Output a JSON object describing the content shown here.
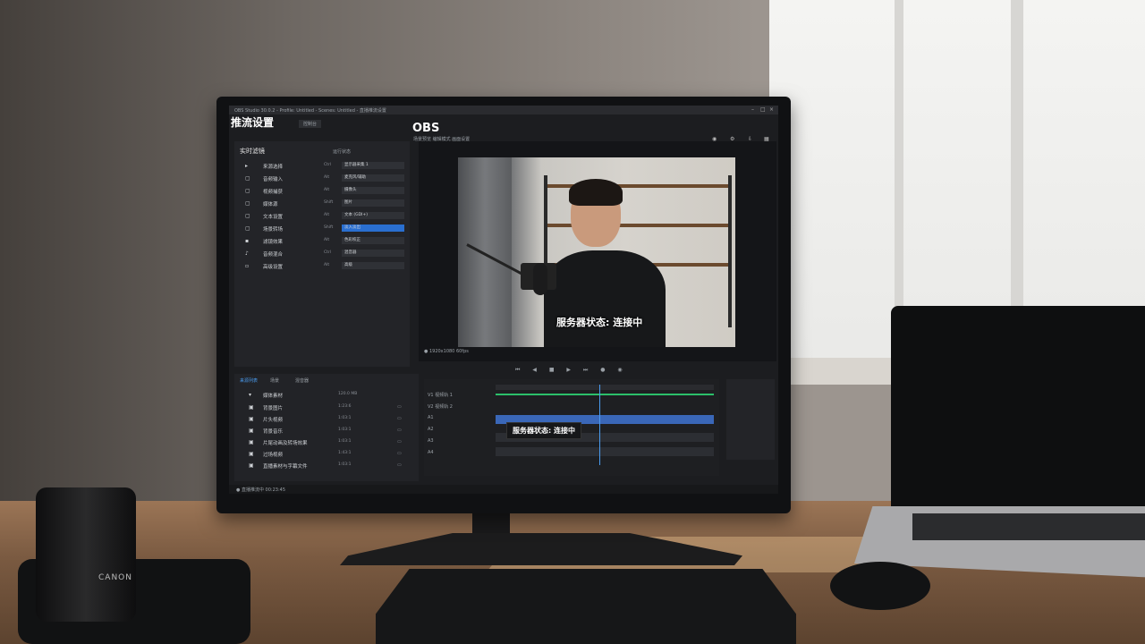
{
  "screen": {
    "titlebar_text": "OBS Studio 30.0.2 - Profile: Untitled - Scenes: Untitled - 直播推流设置",
    "app_title": "推流设置",
    "obs_logo": "OBS",
    "top_tabs": [
      "控制台",
      "设置面板"
    ],
    "left_panel": {
      "header": "实时滤镜",
      "header_right": "运行状态",
      "rows": [
        {
          "icon": "▸",
          "label": "来源选择",
          "key": "Ctrl",
          "value": "显示器采集 1",
          "accent": false
        },
        {
          "icon": "▢",
          "label": "音频输入",
          "key": "Alt",
          "value": "麦克风/辅助",
          "accent": false
        },
        {
          "icon": "▢",
          "label": "视频捕获",
          "key": "Alt",
          "value": "摄像头",
          "accent": false
        },
        {
          "icon": "▢",
          "label": "媒体源",
          "key": "Shift",
          "value": "图片",
          "accent": false
        },
        {
          "icon": "▢",
          "label": "文本设置",
          "key": "Alt",
          "value": "文本 (GDI+)",
          "accent": false
        },
        {
          "icon": "▢",
          "label": "场景转场",
          "key": "Shift",
          "value": "淡入淡出",
          "accent": true
        },
        {
          "icon": "▪",
          "label": "滤镜效果",
          "key": "Alt",
          "value": "色彩校正",
          "accent": false
        },
        {
          "icon": "♪",
          "label": "音频混合",
          "key": "Ctrl",
          "value": "混音器",
          "accent": false
        },
        {
          "icon": "▫",
          "label": "高级设置",
          "key": "Alt",
          "value": "高级",
          "accent": false
        }
      ]
    },
    "preview": {
      "tabs": "场景预览    编辑模式    画面设置",
      "subtitle": "服务器状态: 连接中",
      "status": "● 1920x1080 60fps"
    },
    "transport": "⏮ ◀ ■ ▶ ⏭ ● ◉",
    "bottom_left": {
      "tabs": [
        "来源列表",
        "场景",
        "混音器"
      ],
      "active_tab": 0,
      "folder": "媒体素材",
      "folder_size": "120.0 MB",
      "items": [
        {
          "icon": "▣",
          "name": "背景图片",
          "dur": "1:23:6",
          "ext": "▭"
        },
        {
          "icon": "▣",
          "name": "片头视频",
          "dur": "1:03:1",
          "ext": "▭"
        },
        {
          "icon": "▣",
          "name": "背景音乐",
          "dur": "1:03:1",
          "ext": "▭"
        },
        {
          "icon": "▣",
          "name": "片尾动画及转场效果",
          "dur": "1:03:1",
          "ext": "▭"
        },
        {
          "icon": "▣",
          "name": "过场视频",
          "dur": "1:43:1",
          "ext": "▭"
        },
        {
          "icon": "▣",
          "name": "直播素材与字幕文件",
          "dur": "1:03:1",
          "ext": "▭"
        }
      ]
    },
    "timeline": {
      "labels": [
        "V1 视频轨 1",
        "V2 视频轨 2",
        "A1",
        "A2",
        "A3",
        "A4"
      ],
      "title_clip": "服务器状态: 连接中"
    },
    "statusbar": "● 直播推流中 00:23:45",
    "colors": {
      "accent": "#2a6fd0",
      "clip_green": "#2bbf6a",
      "clip_blue": "#3a67b8"
    }
  },
  "camera_brand": "CANON"
}
